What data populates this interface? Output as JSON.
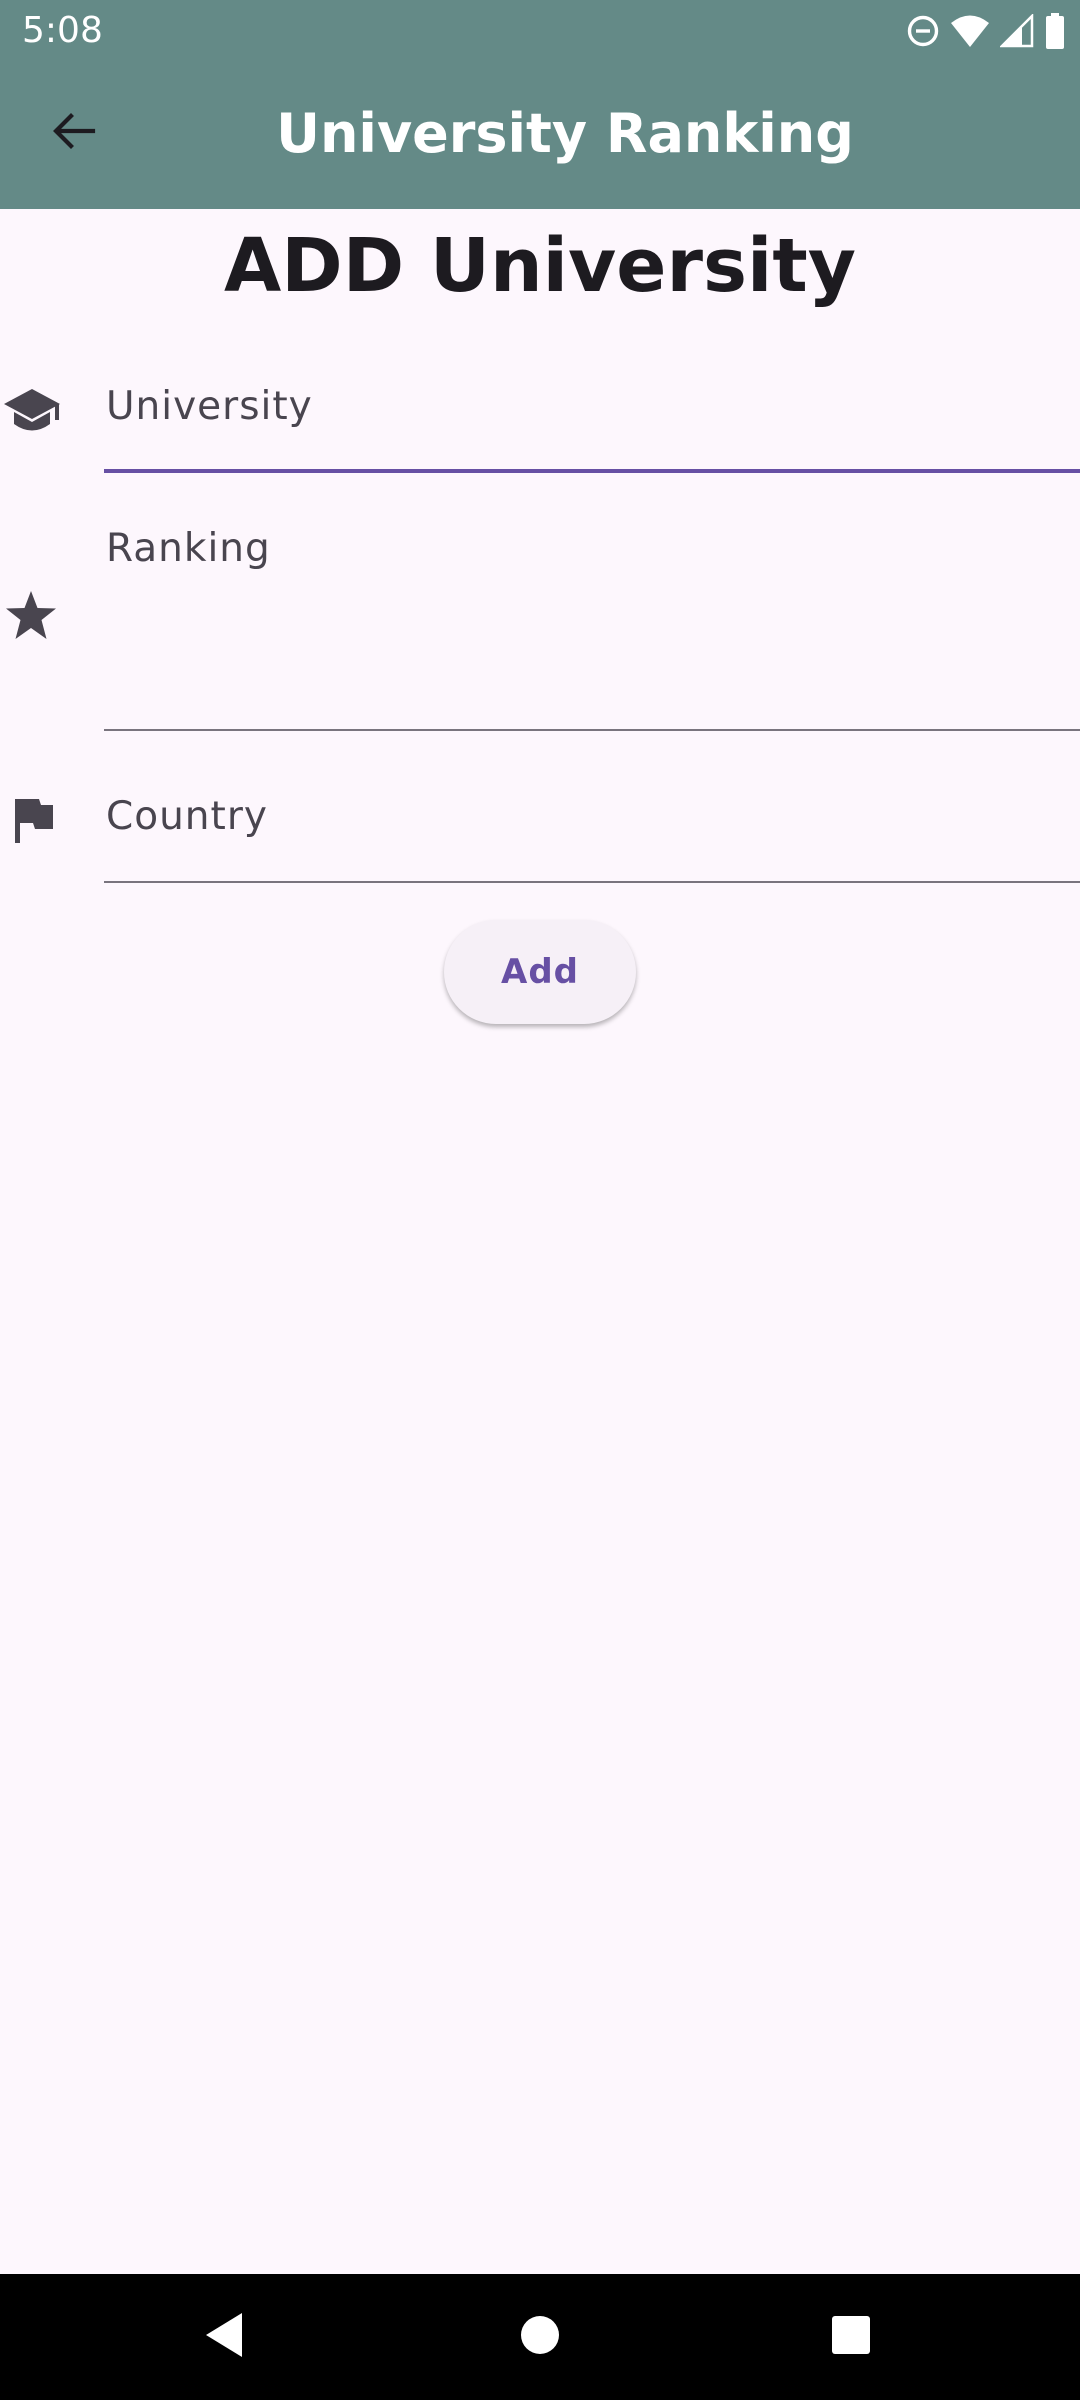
{
  "status_bar": {
    "time": "5:08",
    "icons": [
      "do-not-disturb-icon",
      "wifi-icon",
      "cellular-signal-icon",
      "battery-icon"
    ]
  },
  "app_bar": {
    "title": "University Ranking",
    "back_icon": "arrow-back-icon",
    "background_color": "#648a87"
  },
  "form": {
    "heading": "ADD University",
    "fields": [
      {
        "label": "University",
        "icon": "school-icon",
        "focused": true,
        "value": ""
      },
      {
        "label": "Ranking",
        "icon": "star-icon",
        "focused": false,
        "value": ""
      },
      {
        "label": "Country",
        "icon": "flag-icon",
        "focused": false,
        "value": ""
      }
    ],
    "submit_label": "Add"
  },
  "colors": {
    "accent": "#6750a4",
    "background": "#fdf7fd",
    "text_primary": "#1d1b20",
    "text_secondary": "#49454f"
  },
  "nav_bar": {
    "buttons": [
      "back-triangle-icon",
      "home-circle-icon",
      "recents-square-icon"
    ]
  }
}
